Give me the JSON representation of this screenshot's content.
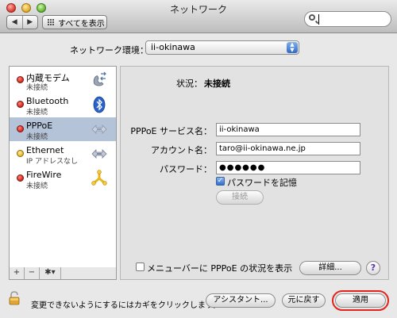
{
  "window": {
    "title": "ネットワーク"
  },
  "toolbar": {
    "show_all_label": "すべてを表示",
    "back_glyph": "◀",
    "forward_glyph": "▶"
  },
  "search": {
    "value": "",
    "placeholder": ""
  },
  "location": {
    "label": "ネットワーク環境：",
    "value": "ii-okinawa",
    "arrows": "▲▼"
  },
  "services": [
    {
      "name": "内蔵モデム",
      "status": "未接続",
      "status_color": "red",
      "icon": "phone-icon",
      "selected": false
    },
    {
      "name": "Bluetooth",
      "status": "未接続",
      "status_color": "red",
      "icon": "bluetooth-icon",
      "selected": false
    },
    {
      "name": "PPPoE",
      "status": "未接続",
      "status_color": "red",
      "icon": "ethernet-arrows-icon",
      "selected": true
    },
    {
      "name": "Ethernet",
      "status": "IP アドレスなし",
      "status_color": "yellow",
      "icon": "ethernet-arrows-icon",
      "selected": false
    },
    {
      "name": "FireWire",
      "status": "未接続",
      "status_color": "red",
      "icon": "firewire-icon",
      "selected": false
    }
  ],
  "list_controls": {
    "add": "+",
    "remove": "−",
    "action": "✱▾"
  },
  "detail": {
    "status_label": "状況：",
    "status_value": "未接続",
    "service_name_label": "PPPoE サービス名：",
    "service_name_value": "ii-okinawa",
    "account_label": "アカウント名：",
    "account_value": "taro@ii-okinawa.ne.jp",
    "password_label": "パスワード：",
    "password_value": "●●●●●●",
    "remember_password_label": "パスワードを記憶",
    "remember_password_checked": true,
    "connect_button": "接続",
    "menubar_status_label": "メニューバーに PPPoE の状況を表示",
    "menubar_status_checked": false,
    "details_button": "詳細...",
    "help_glyph": "?"
  },
  "footer": {
    "lock_text": "変更できないようにするにはカギをクリックします。",
    "assistant_button": "アシスタント...",
    "revert_button": "元に戻す",
    "apply_button": "適用"
  },
  "colors": {
    "highlight_ring": "#e3231c",
    "selection": "#b5c3d8",
    "accent_blue": "#2f69c8"
  }
}
